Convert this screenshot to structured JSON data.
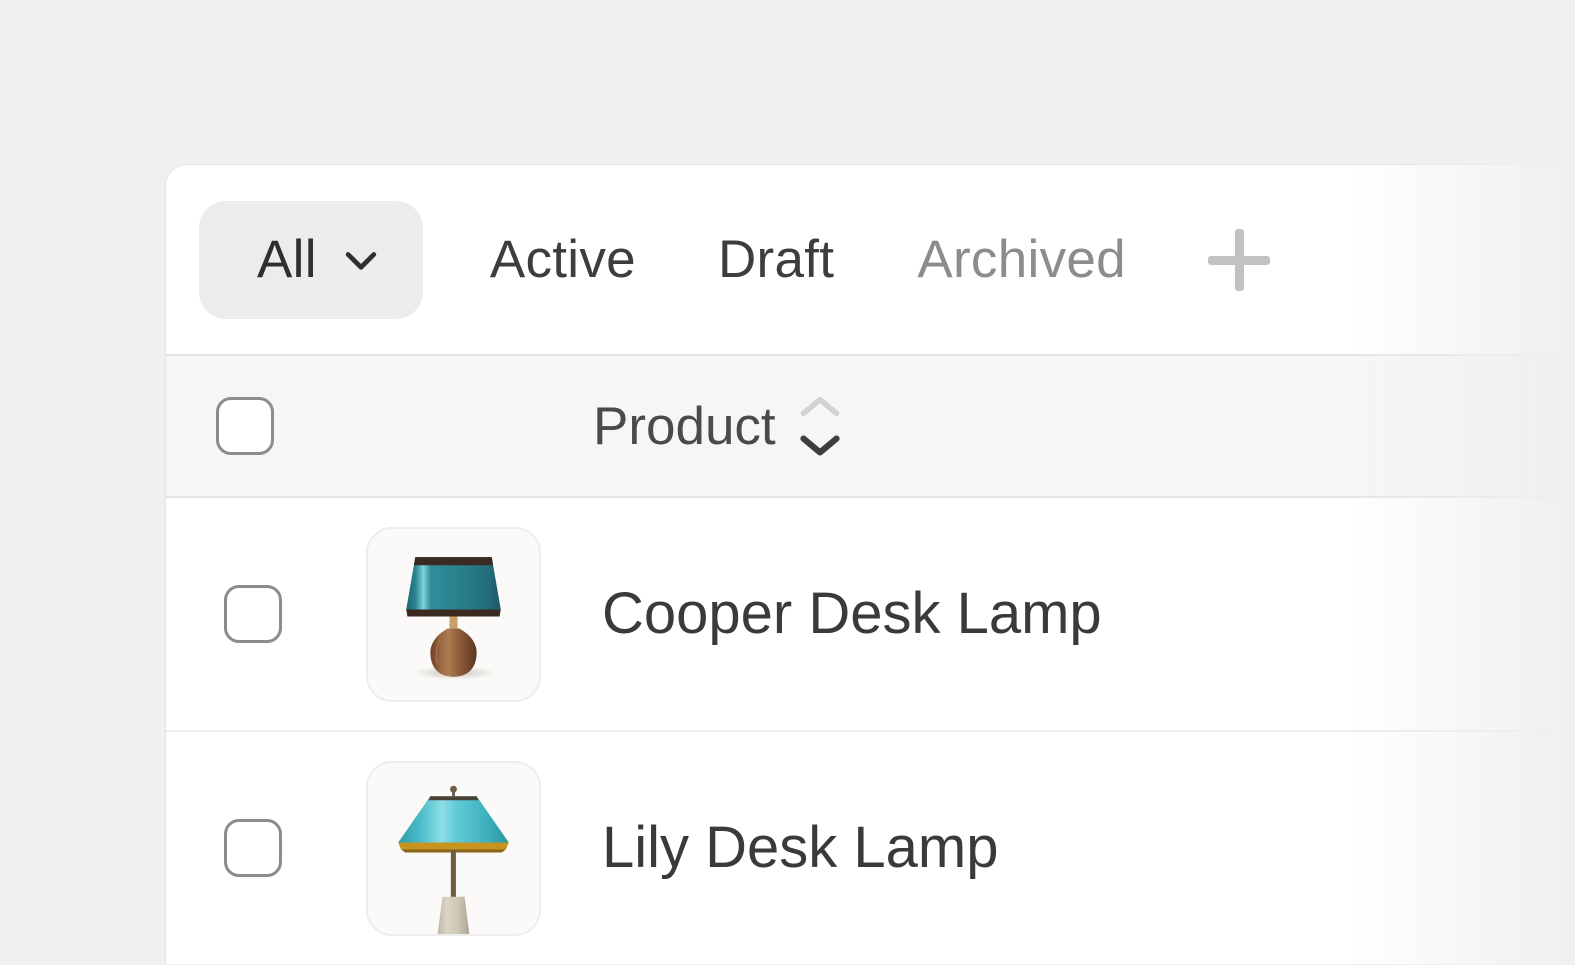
{
  "page": {
    "background_color": "#f0f0f0",
    "card_background": "#ffffff"
  },
  "tabs": {
    "selected": {
      "label": "All",
      "icon": "chevron-down-icon",
      "background_color": "#ececec"
    },
    "items": [
      {
        "label": "Active",
        "color": "#3d3d3d"
      },
      {
        "label": "Draft",
        "color": "#3d3d3d"
      },
      {
        "label": "Archived",
        "color": "#8c8c8c"
      }
    ],
    "add_tab": {
      "icon": "plus-icon",
      "color": "#c2c2c2"
    }
  },
  "table": {
    "select_all_checked": false,
    "columns": [
      {
        "label": "Product",
        "sortable": true,
        "sort_icon": "sort-chevrons-icon",
        "sort_direction": "descending"
      }
    ],
    "rows": [
      {
        "checked": false,
        "thumbnail": "teal-desk-lamp-image",
        "name": "Cooper Desk Lamp",
        "shade_color": "#2c7d8a",
        "base_color": "#8a5a3b"
      },
      {
        "checked": false,
        "thumbnail": "turquoise-desk-lamp-image",
        "name": "Lily Desk Lamp",
        "shade_color": "#4cc0ce",
        "base_color": "#cfc8b6"
      }
    ]
  }
}
